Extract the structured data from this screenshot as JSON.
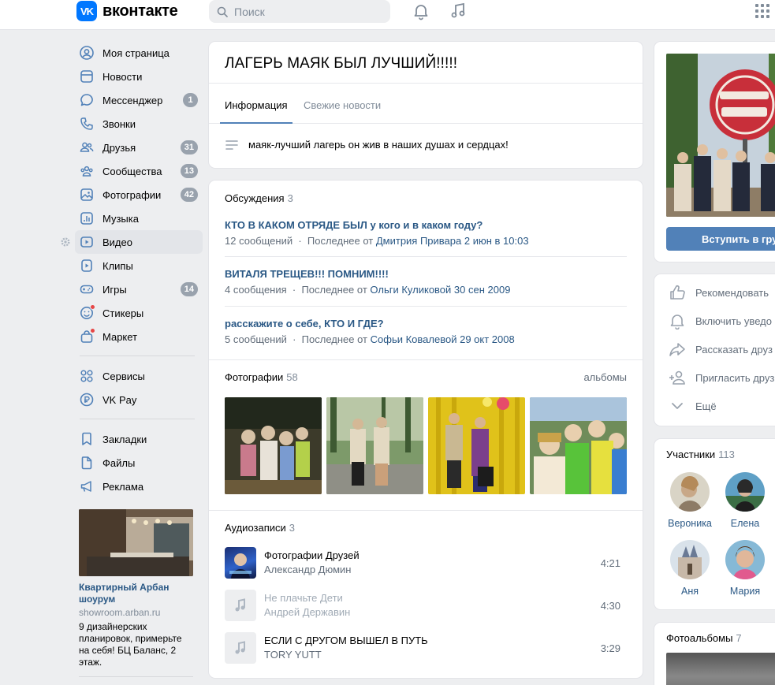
{
  "header": {
    "logo_mark": "VK",
    "logo_text": "вконтакте",
    "search_placeholder": "Поиск"
  },
  "nav": {
    "items": [
      {
        "label": "Моя страница",
        "icon": "user-circle-icon"
      },
      {
        "label": "Новости",
        "icon": "newspaper-icon"
      },
      {
        "label": "Мессенджер",
        "icon": "message-icon",
        "badge": "1"
      },
      {
        "label": "Звонки",
        "icon": "phone-icon"
      },
      {
        "label": "Друзья",
        "icon": "friends-icon",
        "badge": "31"
      },
      {
        "label": "Сообщества",
        "icon": "communities-icon",
        "badge": "13"
      },
      {
        "label": "Фотографии",
        "icon": "photos-icon",
        "badge": "42"
      },
      {
        "label": "Музыка",
        "icon": "music-icon"
      },
      {
        "label": "Видео",
        "icon": "video-icon"
      },
      {
        "label": "Клипы",
        "icon": "clips-icon"
      },
      {
        "label": "Игры",
        "icon": "games-icon",
        "badge": "14"
      },
      {
        "label": "Стикеры",
        "icon": "stickers-icon"
      },
      {
        "label": "Маркет",
        "icon": "market-icon"
      },
      {
        "label": "Сервисы",
        "icon": "services-icon"
      },
      {
        "label": "VK Pay",
        "icon": "vkpay-icon"
      },
      {
        "label": "Закладки",
        "icon": "bookmark-icon"
      },
      {
        "label": "Файлы",
        "icon": "file-icon"
      },
      {
        "label": "Реклама",
        "icon": "megaphone-icon"
      }
    ]
  },
  "ad": {
    "title": "Квартирный Арбан шоурум",
    "domain": "showroom.arban.ru",
    "text": "9 дизайнерских планировок, примерьте на себя! БЦ Баланс, 2 этаж."
  },
  "group": {
    "title": "ЛАГЕРЬ МАЯК БЫЛ ЛУЧШИЙ!!!!!",
    "tabs": [
      "Информация",
      "Свежие новости"
    ],
    "description": "маяк-лучший лагерь он жив в наших душах и сердцах!"
  },
  "discussions": {
    "heading": "Обсуждения",
    "count": "3",
    "topics": [
      {
        "title": "КТО В КАКОМ ОТРЯДЕ БЫЛ у кого и в каком году?",
        "messages": "12 сообщений",
        "last_prefix": "Последнее от",
        "author": "Дмитрия Привара",
        "date": "2 июн в 10:03"
      },
      {
        "title": "ВИТАЛЯ ТРЕЩЕВ!!! ПОМНИМ!!!!",
        "messages": "4 сообщения",
        "last_prefix": "Последнее от",
        "author": "Ольги Куликовой",
        "date": "30 сен 2009"
      },
      {
        "title": "расскажите о себе, КТО И ГДЕ?",
        "messages": "5 сообщений",
        "last_prefix": "Последнее от",
        "author": "Софьи Ковалевой",
        "date": "29 окт 2008"
      }
    ]
  },
  "photos": {
    "heading": "Фотографии",
    "count": "58",
    "albums_link": "альбомы"
  },
  "audio": {
    "heading": "Аудиозаписи",
    "count": "3",
    "tracks": [
      {
        "title": "Фотографии Друзей",
        "artist": "Александр Дюмин",
        "duration": "4:21"
      },
      {
        "title": "Не плачьте Дети",
        "artist": "Андрей Державин",
        "duration": "4:30"
      },
      {
        "title": "ЕСЛИ С ДРУГОМ ВЫШЕЛ В ПУТЬ",
        "artist": "TORY YUTT",
        "duration": "3:29"
      }
    ]
  },
  "right": {
    "join_button": "Вступить в груп",
    "actions": [
      {
        "label": "Рекомендовать",
        "icon": "like-icon"
      },
      {
        "label": "Включить уведо",
        "icon": "bell-icon"
      },
      {
        "label": "Рассказать друз",
        "icon": "share-icon"
      },
      {
        "label": "Пригласить друз",
        "icon": "add-user-icon"
      },
      {
        "label": "Ещё",
        "icon": "chevron-down-icon"
      }
    ],
    "members": {
      "heading": "Участники",
      "count": "113",
      "names": [
        "Вероника",
        "Елена",
        "Аня",
        "Мария"
      ]
    },
    "albums": {
      "heading": "Фотоальбомы",
      "count": "7"
    }
  }
}
